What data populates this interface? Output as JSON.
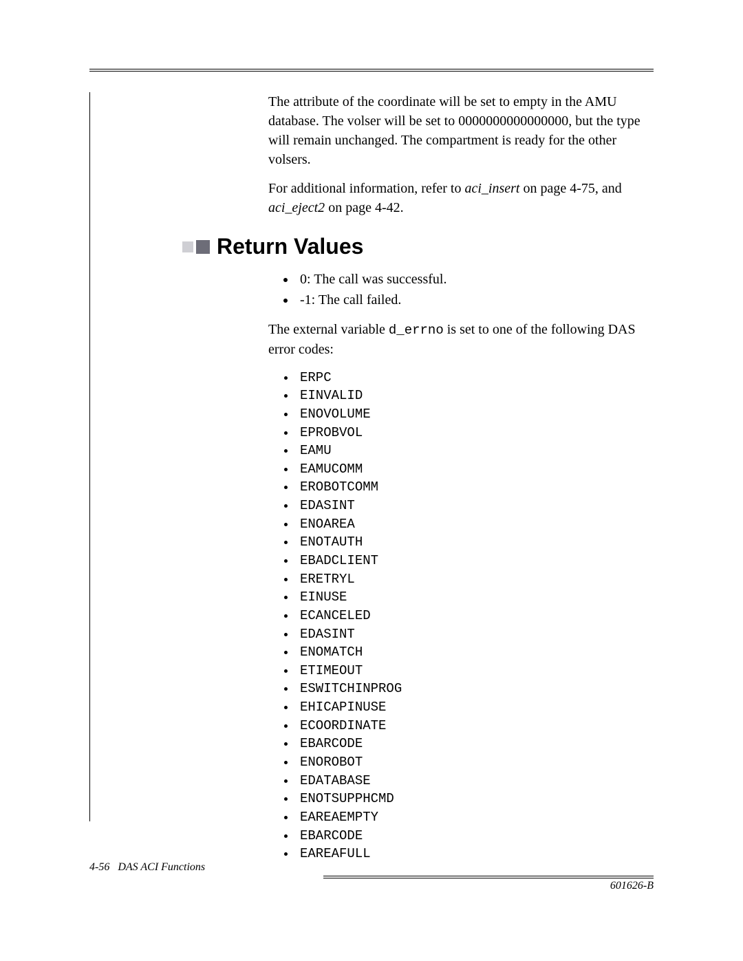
{
  "intro": {
    "para1_a": "The attribute of the coordinate will be set to empty in the AMU database. The volser will be set to 0000000000000000, but the type will remain unchanged. The compartment is ready for the other volsers.",
    "para2_a": "For additional information, refer to ",
    "para2_ref1": "aci_insert",
    "para2_b": "  on page 4-75, and ",
    "para2_ref2": "aci_eject2",
    "para2_c": "  on page 4-42."
  },
  "heading": "Return Values",
  "returns": {
    "items": [
      "0: The call was successful.",
      "-1: The call failed."
    ],
    "post_a": "The external variable ",
    "post_code": "d_errno",
    "post_b": " is set to one of the following DAS error codes:"
  },
  "errors": [
    "ERPC",
    "EINVALID",
    "ENOVOLUME",
    "EPROBVOL",
    "EAMU",
    "EAMUCOMM",
    "EROBOTCOMM",
    "EDASINT",
    "ENOAREA",
    "ENOTAUTH",
    "EBADCLIENT",
    "ERETRYL",
    "EINUSE",
    "ECANCELED",
    "EDASINT",
    "ENOMATCH",
    "ETIMEOUT",
    "ESWITCHINPROG",
    "EHICAPINUSE",
    "ECOORDINATE",
    "EBARCODE",
    "ENOROBOT",
    "EDATABASE",
    "ENOTSUPPHCMD",
    "EAREAEMPTY",
    "EBARCODE",
    "EAREAFULL"
  ],
  "footer": {
    "left_page": "4-56",
    "left_title": "DAS ACI Functions",
    "right": "601626-B"
  }
}
